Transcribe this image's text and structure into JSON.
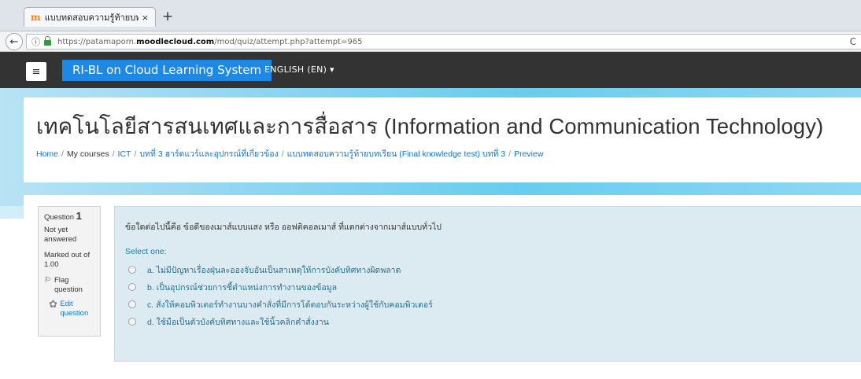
{
  "browser": {
    "tab_title": "แบบทดสอบความรู้ท้ายบทเรี...",
    "tab_favicon": "m",
    "tab_close": "×",
    "new_tab": "+",
    "back_icon": "←",
    "info_icon": "ⓘ",
    "url_prefix": "https://patamaporn.",
    "url_domain": "moodlecloud.com",
    "url_path": "/mod/quiz/attempt.php?attempt=965",
    "reload_icon": "C"
  },
  "navbar": {
    "menu_icon": "≡",
    "brand": "RI-BL on Cloud Learning System",
    "language": "ENGLISH (EN) ▾"
  },
  "header": {
    "title": "เทคโนโลยีสารสนเทศและการสื่อสาร (Information and Communication Technology)",
    "breadcrumb": [
      {
        "label": "Home",
        "link": true
      },
      {
        "label": "My courses",
        "link": false
      },
      {
        "label": "ICT",
        "link": true
      },
      {
        "label": "บทที่ 3 ฮาร์ดแวร์และอุปกรณ์ที่เกี่ยวข้อง",
        "link": true
      },
      {
        "label": "แบบทดสอบความรู้ท้ายบทเรียน (Final knowledge test) บทที่ 3",
        "link": true
      },
      {
        "label": "Preview",
        "link": true
      }
    ],
    "separator": "/"
  },
  "question_info": {
    "question_label": "Question",
    "question_number": "1",
    "state": "Not yet answered",
    "marked_out_of": "Marked out of 1.00",
    "flag_icon": "⚐",
    "flag_label": "Flag question",
    "edit_icon": "✿",
    "edit_label": "Edit question"
  },
  "question": {
    "text": "ข้อใดต่อไปนี้คือ ข้อดีของเมาส์แบบแสง หรือ ออฟติคอลเมาส์ ที่แตกต่างจากเมาส์แบบทั่วไป",
    "prompt": "Select one:",
    "answers": [
      {
        "label": "a. ไม่มีปัญหาเรื่องฝุ่นละอองจับอันเป็นสาเหตุให้การบังคับทิศทางผิดพลาด"
      },
      {
        "label": "b. เป็นอุปกรณ์ช่วยการชี้ตำแหน่งการทำงานของข้อมูล"
      },
      {
        "label": "c. สั่งให้คอมพิวเตอร์ทำงานบางคำสั่งที่มีการโต้ตอบกันระหว่างผู้ใช้กับคอมพิวเตอร์"
      },
      {
        "label": "d. ใช้มือเป็นตัวบังคับทิศทางและใช้นิ้วคลิกคำสั่งงาน"
      }
    ]
  },
  "colors": {
    "navbar": "#333333",
    "brand": "#1e88e5",
    "link": "#1177d1",
    "question_bg": "#dcebf1",
    "banner": "#67cdee"
  }
}
